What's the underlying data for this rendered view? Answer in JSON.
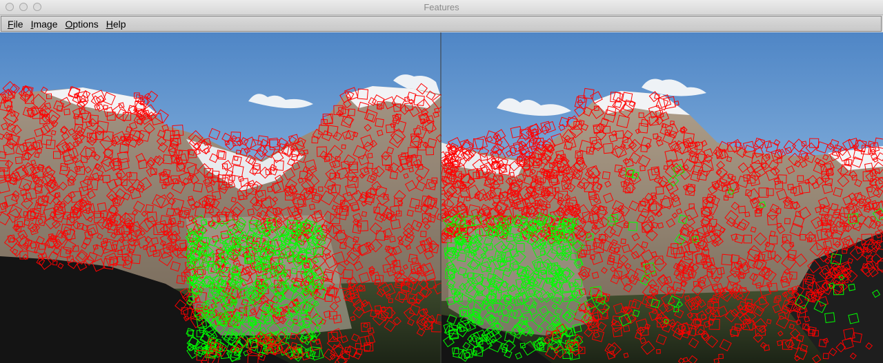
{
  "window": {
    "title": "Features",
    "controls": [
      "close-button",
      "minimize-button",
      "zoom-button"
    ]
  },
  "menu": {
    "items": [
      {
        "mnemonic": "F",
        "rest": "ile"
      },
      {
        "mnemonic": "I",
        "rest": "mage"
      },
      {
        "mnemonic": "O",
        "rest": "ptions"
      },
      {
        "mnemonic": "H",
        "rest": "elp"
      }
    ]
  },
  "viewer": {
    "panels": [
      "left-image",
      "right-image"
    ],
    "marker_colors": {
      "unmatched": "#ff0000",
      "matched": "#00ff00"
    }
  }
}
